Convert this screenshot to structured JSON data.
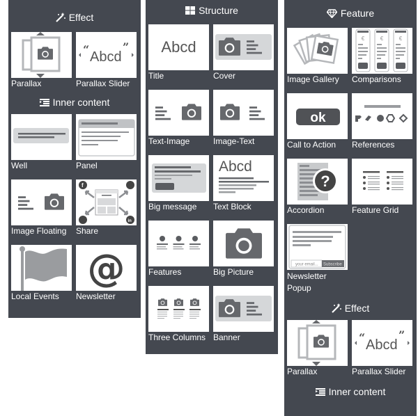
{
  "panels": {
    "left": {
      "sections": [
        {
          "title": "Effect",
          "icon": "magic-wand-icon",
          "items": [
            "Parallax",
            "Parallax Slider"
          ]
        },
        {
          "title": "Inner content",
          "icon": "indent-list-icon",
          "items": [
            "Well",
            "Panel",
            "Image Floating",
            "Share",
            "Local Events",
            "Newsletter"
          ]
        }
      ]
    },
    "middle": {
      "sections": [
        {
          "title": "Structure",
          "icon": "grid-icon",
          "items": [
            "Title",
            "Cover",
            "Text-Image",
            "Image-Text",
            "Big message",
            "Text Block",
            "Features",
            "Big Picture",
            "Three Columns",
            "Banner"
          ]
        }
      ]
    },
    "right": {
      "sections": [
        {
          "title": "Feature",
          "icon": "diamond-icon",
          "items": [
            "Image Gallery",
            "Comparisons",
            "Call to Action",
            "References",
            "Accordion",
            "Feature Grid",
            "Newsletter Popup"
          ]
        },
        {
          "title": "Effect",
          "icon": "magic-wand-icon",
          "items": [
            "Parallax",
            "Parallax Slider"
          ]
        },
        {
          "title": "Inner content",
          "icon": "indent-list-icon",
          "items": []
        }
      ]
    }
  },
  "thumb_text": {
    "abcd": "Abcd",
    "ok": "ok",
    "email_placeholder": "your email...",
    "subscribe": "Subscribe"
  },
  "colors": {
    "panel_bg": "#444850",
    "icon_dark": "#5f6166",
    "icon_mid": "#8c8e92",
    "icon_light": "#c9cbcd"
  }
}
